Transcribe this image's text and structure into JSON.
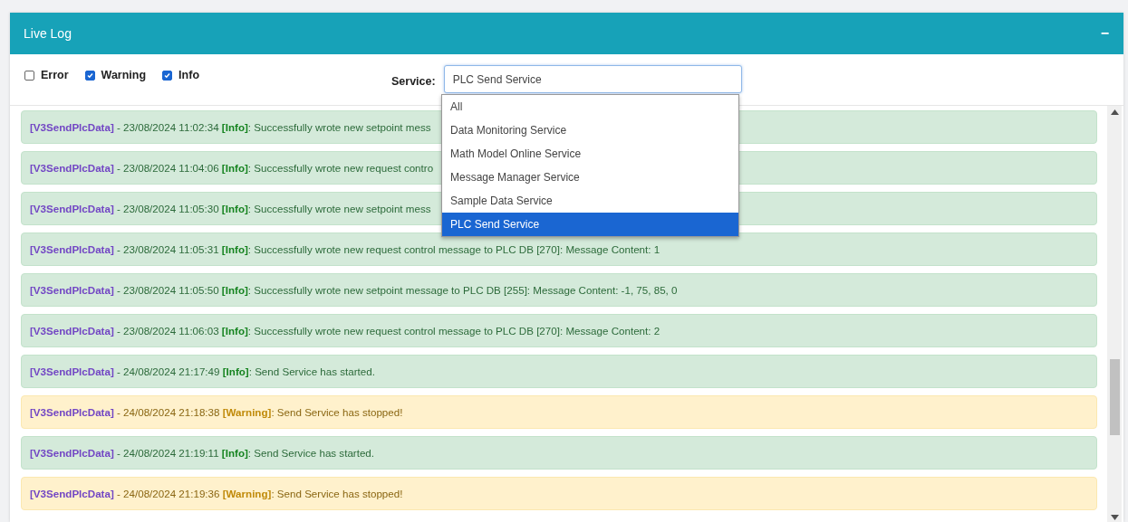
{
  "panel": {
    "title": "Live Log",
    "collapse_symbol": "−"
  },
  "filters": [
    {
      "label": "Error",
      "checked": false
    },
    {
      "label": "Warning",
      "checked": true
    },
    {
      "label": "Info",
      "checked": true
    }
  ],
  "service": {
    "label": "Service:",
    "value": "PLC Send Service",
    "dropdown_open": true,
    "options": [
      {
        "label": "All",
        "selected": false
      },
      {
        "label": "Data Monitoring Service",
        "selected": false
      },
      {
        "label": "Math Model Online Service",
        "selected": false
      },
      {
        "label": "Message Manager Service",
        "selected": false
      },
      {
        "label": "Sample Data Service",
        "selected": false
      },
      {
        "label": "PLC Send Service",
        "selected": true
      }
    ]
  },
  "entries": [
    {
      "kind": "info",
      "source": "[V3SendPlcData]",
      "timestamp": "- 23/08/2024 11:02:34",
      "level": "[Info]",
      "message": ": Successfully wrote new setpoint mess"
    },
    {
      "kind": "info",
      "source": "[V3SendPlcData]",
      "timestamp": "- 23/08/2024 11:04:06",
      "level": "[Info]",
      "message": ": Successfully wrote new request contro"
    },
    {
      "kind": "info",
      "source": "[V3SendPlcData]",
      "timestamp": "- 23/08/2024 11:05:30",
      "level": "[Info]",
      "message": ": Successfully wrote new setpoint mess"
    },
    {
      "kind": "info",
      "source": "[V3SendPlcData]",
      "timestamp": "- 23/08/2024 11:05:31",
      "level": "[Info]",
      "message": ": Successfully wrote new request control message to PLC DB [270]: Message Content: 1"
    },
    {
      "kind": "info",
      "source": "[V3SendPlcData]",
      "timestamp": "- 23/08/2024 11:05:50",
      "level": "[Info]",
      "message": ": Successfully wrote new setpoint message to PLC DB [255]: Message Content: -1, 75, 85, 0"
    },
    {
      "kind": "info",
      "source": "[V3SendPlcData]",
      "timestamp": "- 23/08/2024 11:06:03",
      "level": "[Info]",
      "message": ": Successfully wrote new request control message to PLC DB [270]: Message Content: 2"
    },
    {
      "kind": "info",
      "source": "[V3SendPlcData]",
      "timestamp": "- 24/08/2024 21:17:49",
      "level": "[Info]",
      "message": ": Send Service has started."
    },
    {
      "kind": "warning",
      "source": "[V3SendPlcData]",
      "timestamp": "- 24/08/2024 21:18:38",
      "level": "[Warning]",
      "message": ": Send Service has stopped!"
    },
    {
      "kind": "info",
      "source": "[V3SendPlcData]",
      "timestamp": "- 24/08/2024 21:19:11",
      "level": "[Info]",
      "message": ": Send Service has started."
    },
    {
      "kind": "warning",
      "source": "[V3SendPlcData]",
      "timestamp": "- 24/08/2024 21:19:36",
      "level": "[Warning]",
      "message": ": Send Service has stopped!"
    }
  ]
}
